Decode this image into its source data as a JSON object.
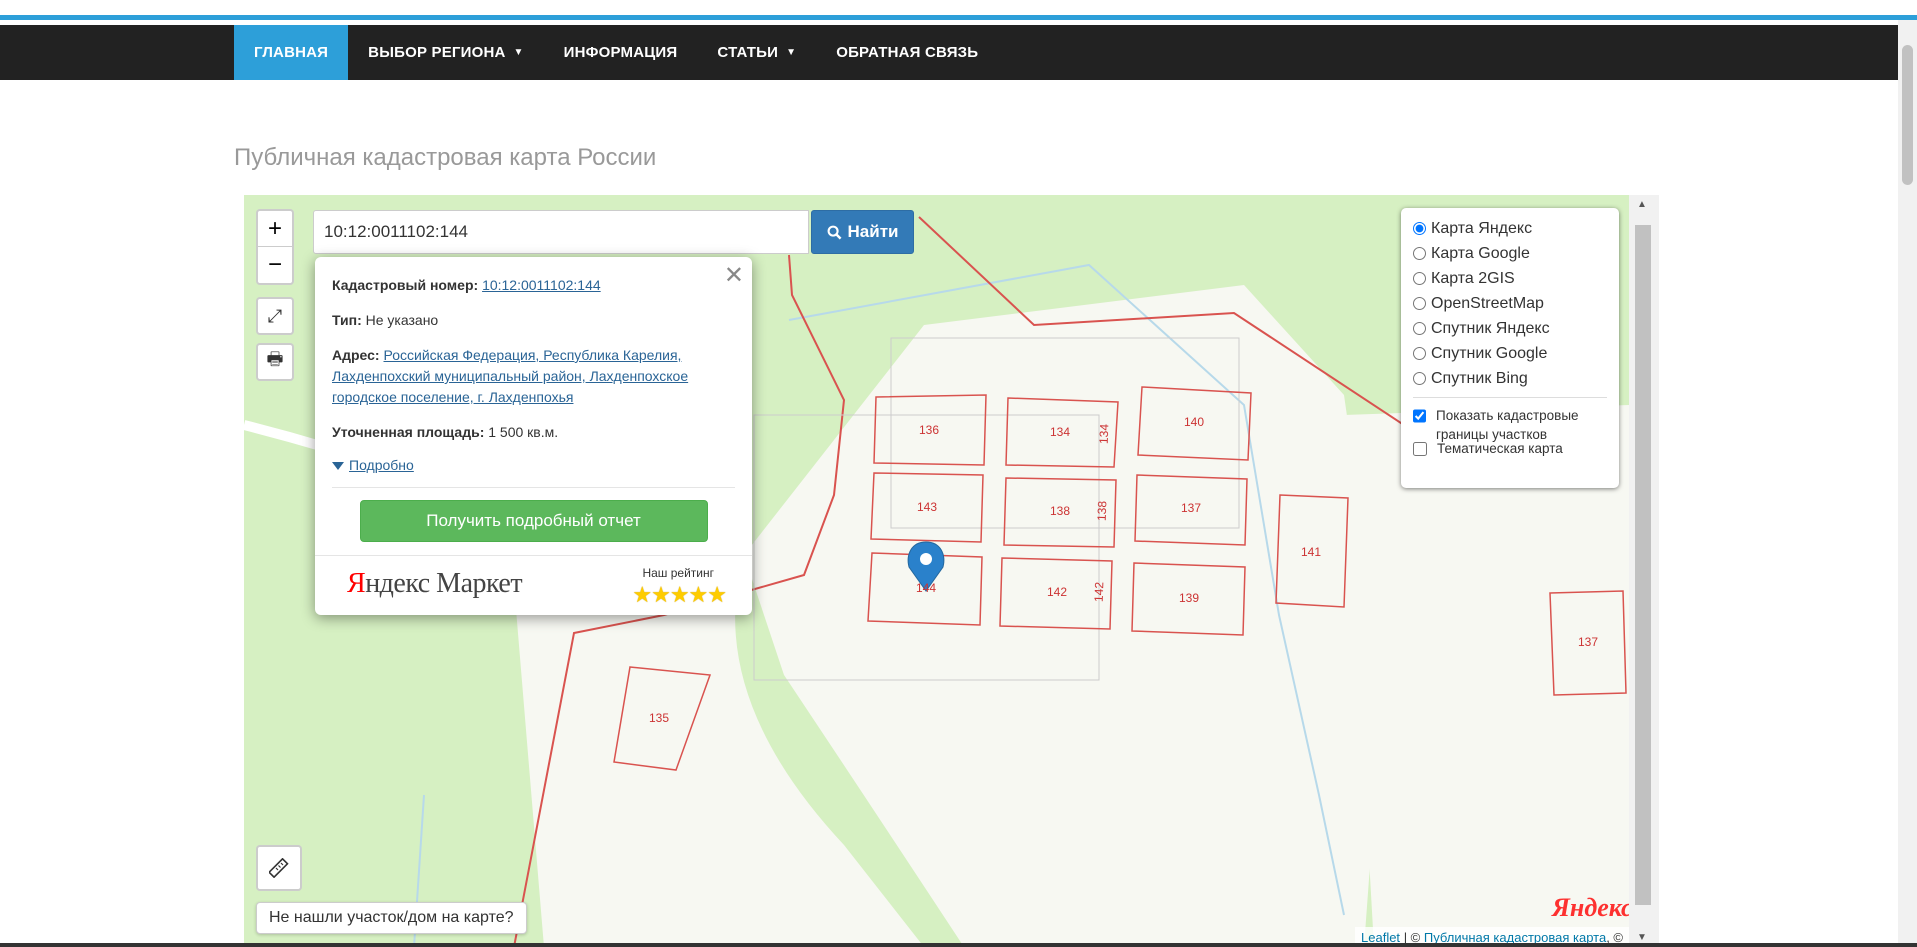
{
  "nav": {
    "items": [
      {
        "label": "ГЛАВНАЯ",
        "active": true
      },
      {
        "label": "ВЫБОР РЕГИОНА",
        "caret": true
      },
      {
        "label": "ИНФОРМАЦИЯ"
      },
      {
        "label": "СТАТЬИ",
        "caret": true
      },
      {
        "label": "ОБРАТНАЯ СВЯЗЬ"
      }
    ]
  },
  "page": {
    "title": "Публичная кадастровая карта России"
  },
  "search": {
    "value": "10:12:0011102:144",
    "button_label": "Найти"
  },
  "popup": {
    "cadastral_label": "Кадастровый номер:",
    "cadastral_value": "10:12:0011102:144",
    "type_label": "Тип:",
    "type_value": "Не указано",
    "address_label": "Адрес:",
    "address_value": "Российская Федерация, Республика Карелия, Лахденпохский муниципальный район, Лахденпохское городское поселение, г. Лахденпохья",
    "area_label": "Уточненная площадь:",
    "area_value": "1 500 кв.м.",
    "more_label": "Подробно",
    "report_button": "Получить подробный отчет",
    "market_logo_red": "Я",
    "market_logo_rest": "ндекс Маркет",
    "rating_label": "Наш рейтинг",
    "stars": "★★★★★",
    "close_glyph": "✕"
  },
  "layers": {
    "options": [
      {
        "label": "Карта Яндекс",
        "checked": true
      },
      {
        "label": "Карта Google"
      },
      {
        "label": "Карта 2GIS"
      },
      {
        "label": "OpenStreetMap"
      },
      {
        "label": "Спутник Яндекс"
      },
      {
        "label": "Спутник Google"
      },
      {
        "label": "Спутник Bing"
      }
    ],
    "show_borders": "Показать кадастровые границы участков",
    "thematic": "Тематическая карта"
  },
  "map": {
    "parcels": [
      "136",
      "134",
      "134",
      "140",
      "143",
      "138",
      "138",
      "137",
      "141",
      "144",
      "142",
      "142",
      "139",
      "137",
      "135"
    ],
    "not_found": "Не нашли участок/дом на карте?",
    "yandex_logo_red": "Я",
    "yandex_logo_rest": "ндекс",
    "attribution_leaflet": "Leaflet",
    "attribution_sep": "| ©",
    "attribution_pkk": "Публичная кадастровая карта",
    "attribution_end": ", ©"
  },
  "icons": {
    "zoom_in": "+",
    "zoom_out": "−",
    "fullscreen": "⤢",
    "print": "🖶",
    "ruler": "📏",
    "caret": "▼"
  },
  "colors": {
    "accent": "#2d9fd9",
    "parcel_border": "#d9534f",
    "map_green": "#d6f0c2",
    "report_green": "#5cb85c",
    "button_blue": "#337ab7"
  }
}
